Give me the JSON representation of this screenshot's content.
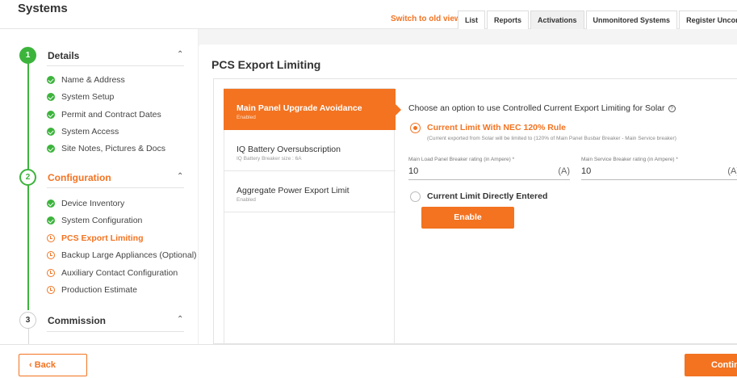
{
  "app": {
    "title": "Systems",
    "accent": "#f37321",
    "success": "#3cb43c"
  },
  "header": {
    "switch_view": "Switch to old view",
    "tabs": [
      {
        "label": "List",
        "active": false
      },
      {
        "label": "Reports",
        "active": false
      },
      {
        "label": "Activations",
        "active": true
      },
      {
        "label": "Unmonitored Systems",
        "active": false
      },
      {
        "label": "Register Unconnected M",
        "active": false
      }
    ]
  },
  "sidebar": {
    "sections": [
      {
        "number": "1",
        "title": "Details",
        "state": "done",
        "items": [
          {
            "label": "Name & Address",
            "status": "complete"
          },
          {
            "label": "System Setup",
            "status": "complete"
          },
          {
            "label": "Permit and Contract Dates",
            "status": "complete"
          },
          {
            "label": "System Access",
            "status": "complete"
          },
          {
            "label": "Site Notes, Pictures & Docs",
            "status": "complete"
          }
        ]
      },
      {
        "number": "2",
        "title": "Configuration",
        "state": "current",
        "items": [
          {
            "label": "Device Inventory",
            "status": "complete"
          },
          {
            "label": "System Configuration",
            "status": "complete"
          },
          {
            "label": "PCS Export Limiting",
            "status": "active"
          },
          {
            "label": "Backup Large Appliances (Optional)",
            "status": "pending"
          },
          {
            "label": "Auxiliary Contact Configuration",
            "status": "pending"
          },
          {
            "label": "Production Estimate",
            "status": "pending"
          }
        ]
      },
      {
        "number": "3",
        "title": "Commission",
        "state": "todo",
        "items": []
      }
    ]
  },
  "main": {
    "title": "PCS Export Limiting",
    "options": [
      {
        "title": "Main Panel Upgrade Avoidance",
        "subtitle": "Enabled",
        "active": true
      },
      {
        "title": "IQ Battery Oversubscription",
        "subtitle": "IQ Battery Breaker size : 6A",
        "active": false
      },
      {
        "title": "Aggregate Power Export Limit",
        "subtitle": "Enabled",
        "active": false
      }
    ],
    "config": {
      "question": "Choose an option to use  Controlled Current Export Limiting for Solar",
      "radio1": {
        "label": "Current Limit With NEC 120% Rule",
        "note": "(Current exported from Solar will be limited to (120% of Main Panel Busbar Breaker - Main Service breaker)",
        "selected": true
      },
      "field1": {
        "label": "Main Load Panel Breaker rating (in Ampere) *",
        "value": "10",
        "unit": "(A)"
      },
      "field2": {
        "label": "Main Service Breaker rating (in Ampere) *",
        "value": "10",
        "unit": "(A)"
      },
      "radio2": {
        "label": "Current Limit Directly Entered",
        "selected": false
      },
      "enable_button": "Enable"
    }
  },
  "footer": {
    "back": "Back",
    "continue": "Continue"
  }
}
